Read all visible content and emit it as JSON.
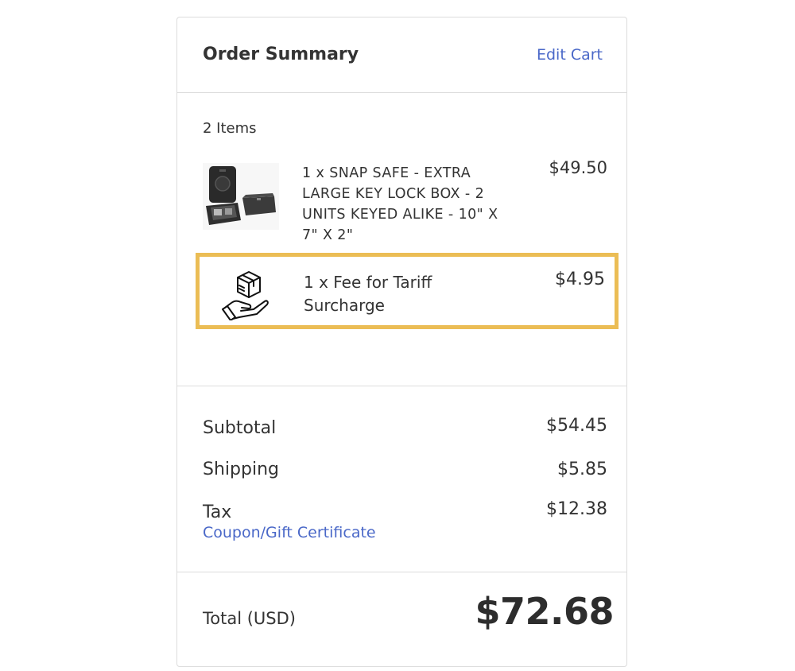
{
  "header": {
    "title": "Order Summary",
    "edit_cart_label": "Edit Cart"
  },
  "items": {
    "count_label": "2 Items",
    "list": [
      {
        "name": "1 x SNAP SAFE - EXTRA LARGE KEY LOCK BOX - 2 UNITS KEYED ALIKE - 10\" X 7\" X 2\"",
        "price": "$49.50",
        "icon": "product-image"
      },
      {
        "name": "1 x Fee for Tariff Surcharge",
        "price": "$4.95",
        "icon": "package-in-hand-icon"
      }
    ]
  },
  "totals": {
    "subtotal_label": "Subtotal",
    "subtotal_value": "$54.45",
    "shipping_label": "Shipping",
    "shipping_value": "$5.85",
    "tax_label": "Tax",
    "tax_value": "$12.38",
    "coupon_label": "Coupon/Gift Certificate"
  },
  "grand_total": {
    "label": "Total (USD)",
    "value": "$72.68"
  },
  "colors": {
    "link": "#4a68c8",
    "highlight": "#ebbd55",
    "divider": "#dcdcdc",
    "text": "#333333"
  }
}
